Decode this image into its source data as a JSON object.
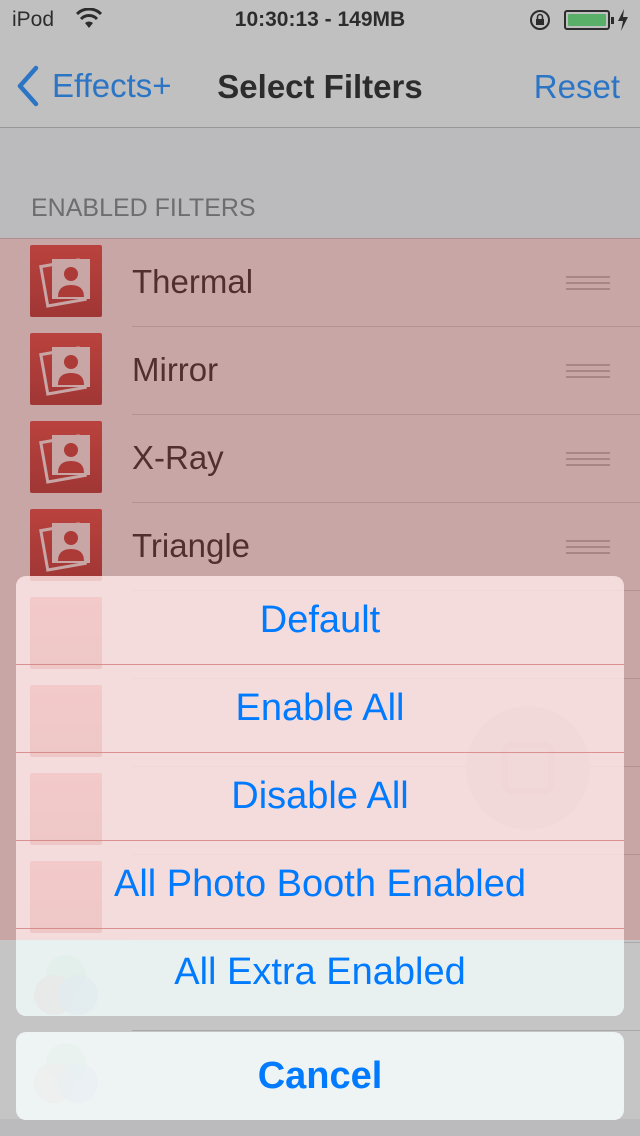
{
  "status_bar": {
    "carrier": "iPod",
    "time": "10:30:13 - 149MB",
    "icons": [
      "wifi-icon",
      "rotation-lock-icon",
      "battery-icon",
      "charging-bolt-icon"
    ],
    "battery_color": "#4cd964"
  },
  "nav": {
    "back_label": "Effects+",
    "title": "Select Filters",
    "reset_label": "Reset",
    "tint": "#007aff"
  },
  "section_header": "ENABLED FILTERS",
  "filters": [
    {
      "label": "Thermal",
      "icon": "photo-booth-icon"
    },
    {
      "label": "Mirror",
      "icon": "photo-booth-icon"
    },
    {
      "label": "X-Ray",
      "icon": "photo-booth-icon"
    },
    {
      "label": "Triangle",
      "icon": "photo-booth-icon"
    }
  ],
  "action_sheet": {
    "buttons": [
      "Default",
      "Enable All",
      "Disable All",
      "All Photo Booth Enabled",
      "All Extra Enabled"
    ],
    "cancel_label": "Cancel"
  }
}
